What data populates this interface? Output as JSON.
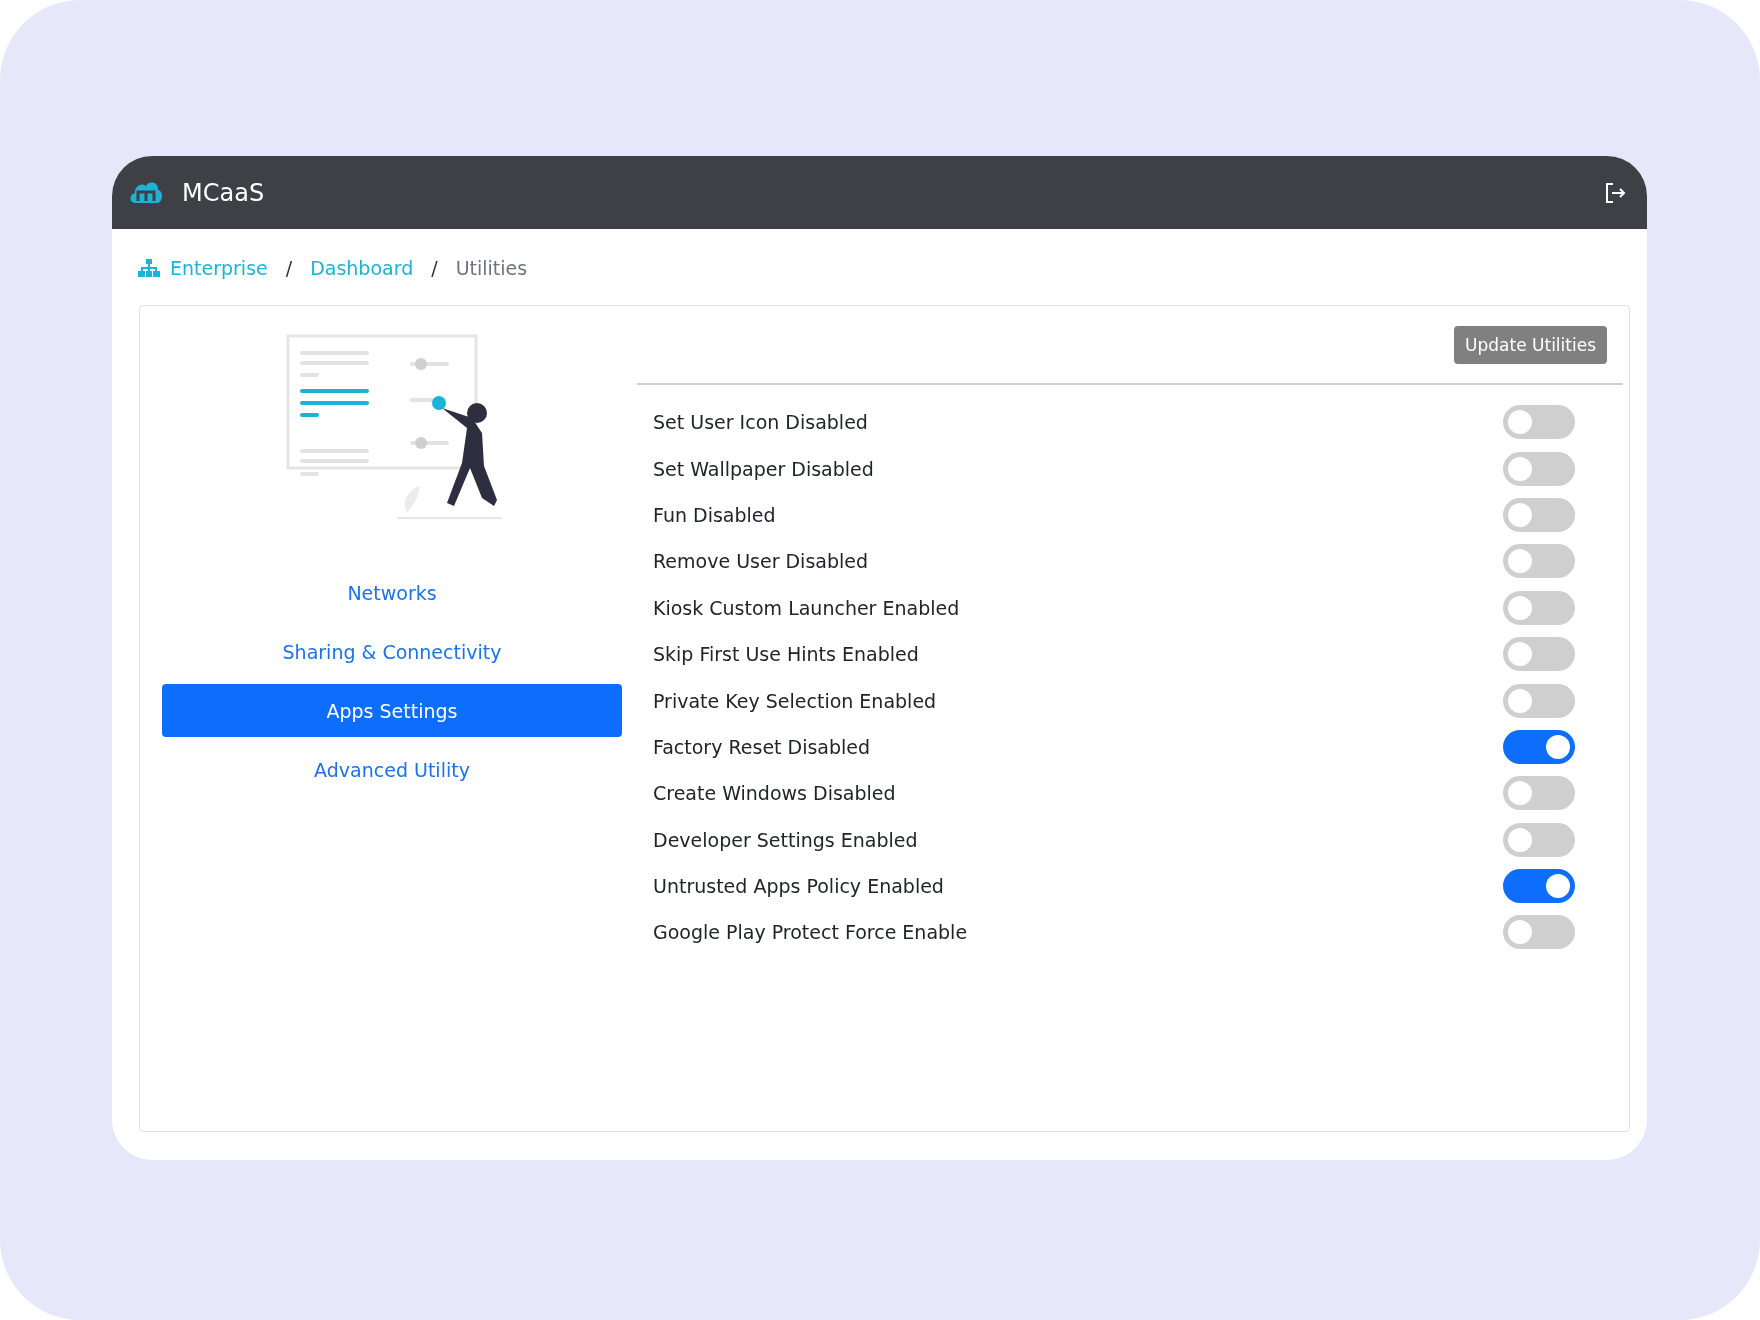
{
  "header": {
    "title": "MCaaS"
  },
  "breadcrumb": [
    {
      "label": "Enterprise",
      "kind": "link"
    },
    {
      "label": "Dashboard",
      "kind": "link"
    },
    {
      "label": "Utilities",
      "kind": "current"
    }
  ],
  "breadcrumb_separator": "/",
  "sidebar": {
    "items": [
      {
        "label": "Networks",
        "selected": false
      },
      {
        "label": "Sharing & Connectivity",
        "selected": false
      },
      {
        "label": "Apps Settings",
        "selected": true
      },
      {
        "label": "Advanced Utility",
        "selected": false
      }
    ]
  },
  "update_button": "Update Utilities",
  "settings": [
    {
      "label": "Set User Icon Disabled",
      "on": false
    },
    {
      "label": "Set Wallpaper Disabled",
      "on": false
    },
    {
      "label": "Fun Disabled",
      "on": false
    },
    {
      "label": "Remove User Disabled",
      "on": false
    },
    {
      "label": "Kiosk Custom Launcher Enabled",
      "on": false
    },
    {
      "label": "Skip First Use Hints Enabled",
      "on": false
    },
    {
      "label": "Private Key Selection Enabled",
      "on": false
    },
    {
      "label": "Factory Reset Disabled",
      "on": true
    },
    {
      "label": "Create Windows Disabled",
      "on": false
    },
    {
      "label": "Developer Settings Enabled",
      "on": false
    },
    {
      "label": "Untrusted Apps Policy Enabled",
      "on": true
    },
    {
      "label": "Google Play Protect Force Enable",
      "on": false
    }
  ]
}
